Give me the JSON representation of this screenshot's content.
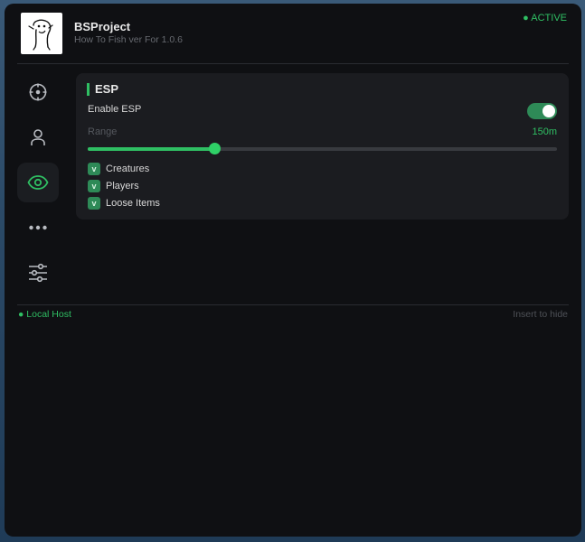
{
  "header": {
    "title": "BSProject",
    "subtitle": "How To Fish ver For 1.0.6",
    "status": "● ACTIVE",
    "logo_icon": "doodle-mascot-icon"
  },
  "sidebar": {
    "items": [
      {
        "icon": "crosshair-icon",
        "active": false
      },
      {
        "icon": "user-icon",
        "active": false
      },
      {
        "icon": "eye-icon",
        "active": true
      },
      {
        "icon": "more-dots-icon",
        "active": false
      },
      {
        "icon": "sliders-icon",
        "active": false
      }
    ]
  },
  "esp": {
    "title": "ESP",
    "enable_label": "Enable ESP",
    "enable_on": true,
    "range_label": "Range",
    "range_value": "150m",
    "range_fraction": 0.27,
    "checks": [
      {
        "mark": "v",
        "label": "Creatures",
        "checked": true
      },
      {
        "mark": "v",
        "label": "Players",
        "checked": true
      },
      {
        "mark": "v",
        "label": "Loose Items",
        "checked": true
      }
    ]
  },
  "footer": {
    "left": "● Local Host",
    "right": "Insert to hide"
  },
  "colors": {
    "accent": "#2fbf63",
    "background": "#0f1013",
    "panel": "#1b1c20"
  }
}
